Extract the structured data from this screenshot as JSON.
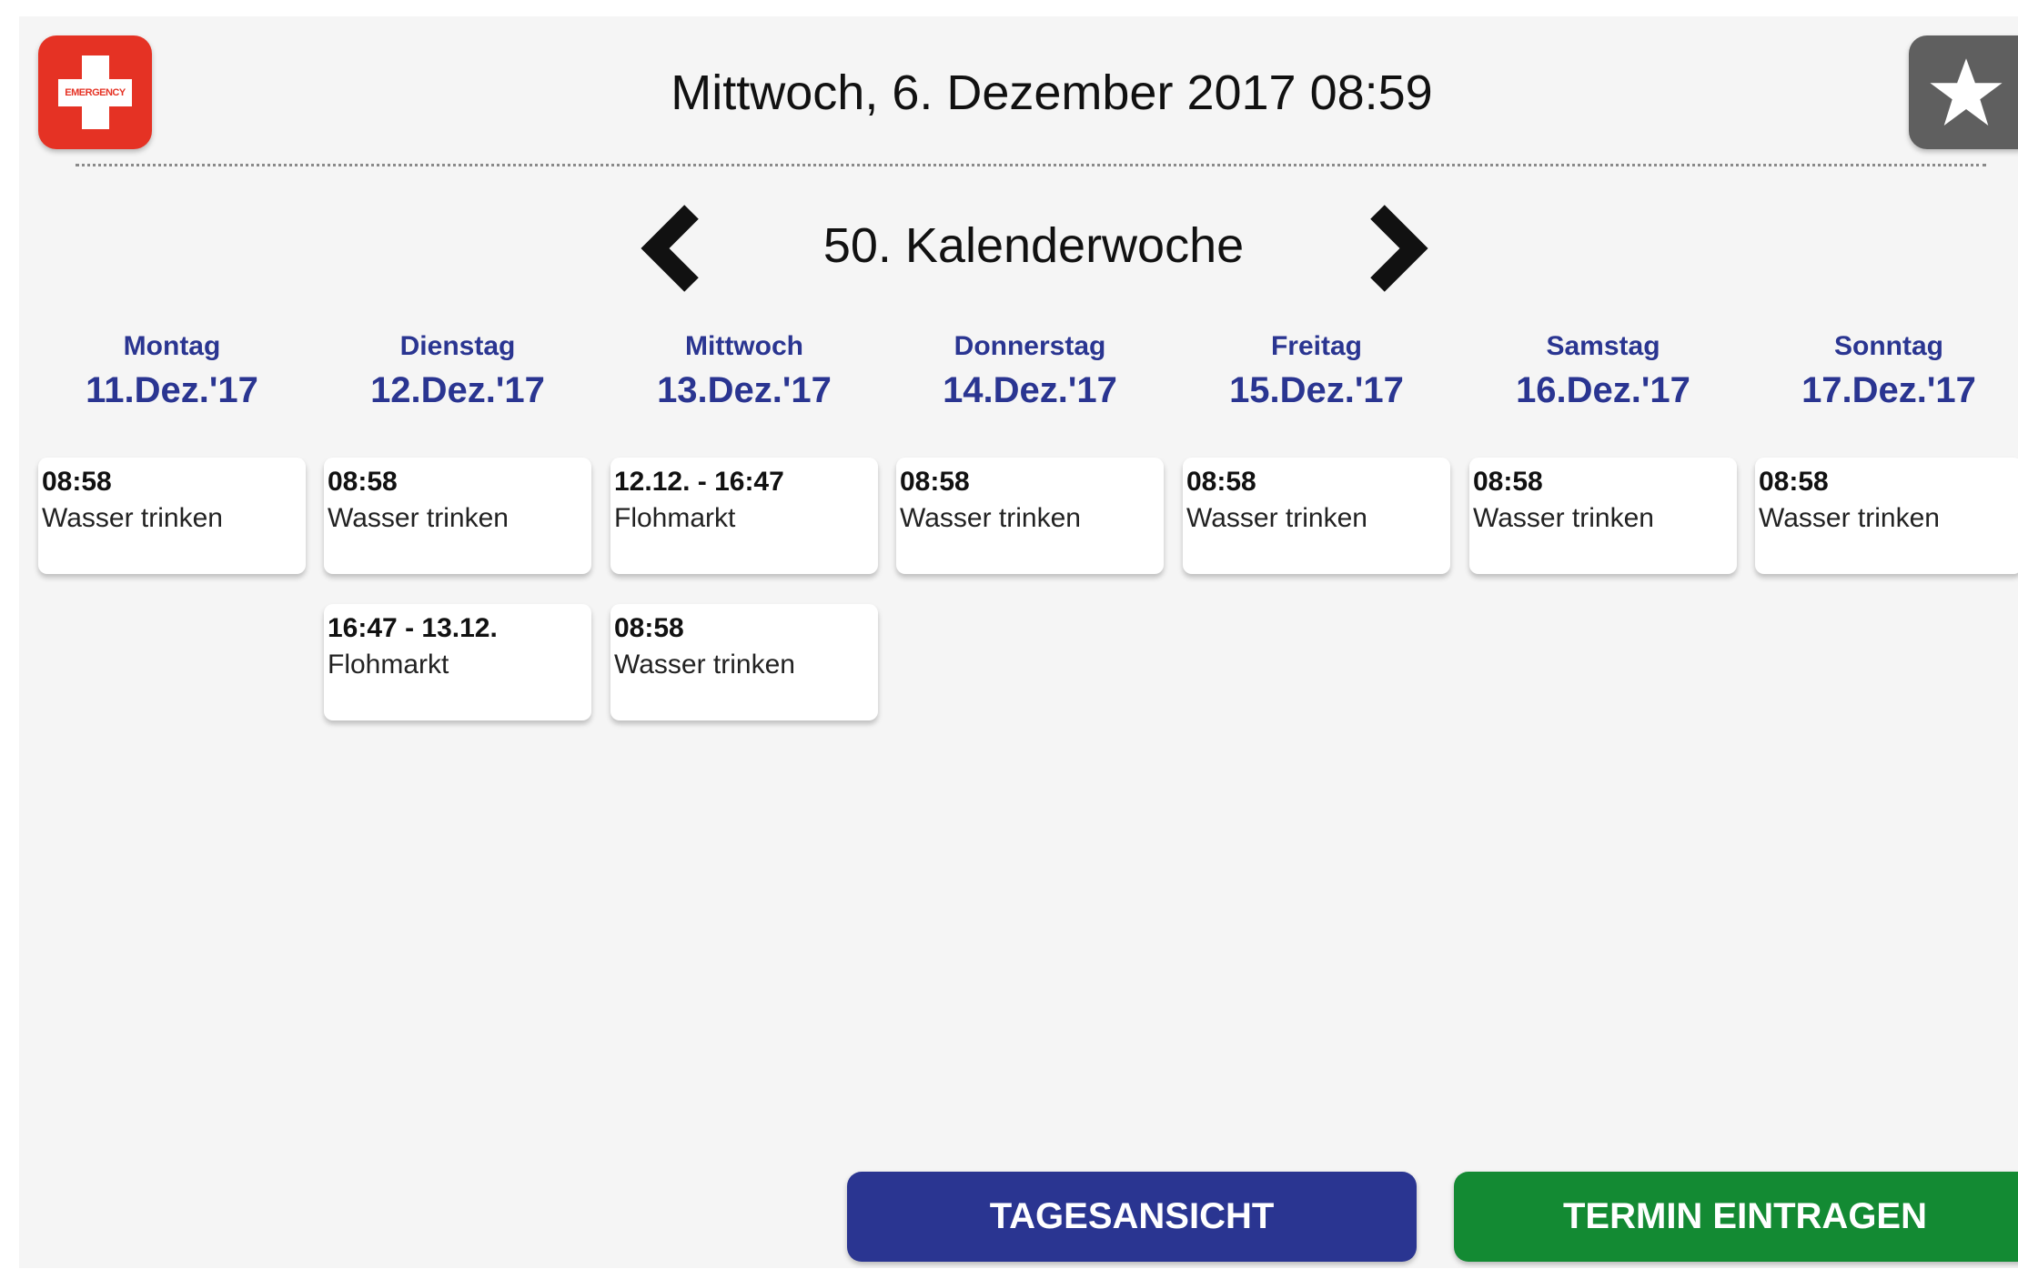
{
  "header": {
    "emergency_icon": "emergency-cross-icon",
    "emergency_text": "EMERGENCY",
    "datetime": "Mittwoch, 6. Dezember 2017 08:59",
    "favorites_icon": "star-icon"
  },
  "week_nav": {
    "prev_icon": "chevron-left-icon",
    "next_icon": "chevron-right-icon",
    "label": "50. Kalenderwoche"
  },
  "days": [
    {
      "name": "Montag",
      "date": "11.Dez.'17",
      "events": [
        {
          "time": "08:58",
          "title": "Wasser trinken"
        }
      ]
    },
    {
      "name": "Dienstag",
      "date": "12.Dez.'17",
      "events": [
        {
          "time": "08:58",
          "title": "Wasser trinken"
        },
        {
          "time": "16:47 - 13.12.",
          "title": "Flohmarkt"
        }
      ]
    },
    {
      "name": "Mittwoch",
      "date": "13.Dez.'17",
      "events": [
        {
          "time": "12.12. - 16:47",
          "title": "Flohmarkt"
        },
        {
          "time": "08:58",
          "title": "Wasser trinken"
        }
      ]
    },
    {
      "name": "Donnerstag",
      "date": "14.Dez.'17",
      "events": [
        {
          "time": "08:58",
          "title": "Wasser trinken"
        }
      ]
    },
    {
      "name": "Freitag",
      "date": "15.Dez.'17",
      "events": [
        {
          "time": "08:58",
          "title": "Wasser trinken"
        }
      ]
    },
    {
      "name": "Samstag",
      "date": "16.Dez.'17",
      "events": [
        {
          "time": "08:58",
          "title": "Wasser trinken"
        }
      ]
    },
    {
      "name": "Sonntag",
      "date": "17.Dez.'17",
      "events": [
        {
          "time": "08:58",
          "title": "Wasser trinken"
        }
      ]
    }
  ],
  "buttons": {
    "day_view": "TAGESANSICHT",
    "add_appointment": "TERMIN EINTRAGEN"
  },
  "colors": {
    "accent_blue": "#2a3591",
    "accent_green": "#138a33",
    "emergency_red": "#e53224",
    "favorites_gray": "#5f5f5f",
    "background": "#f5f5f5"
  }
}
